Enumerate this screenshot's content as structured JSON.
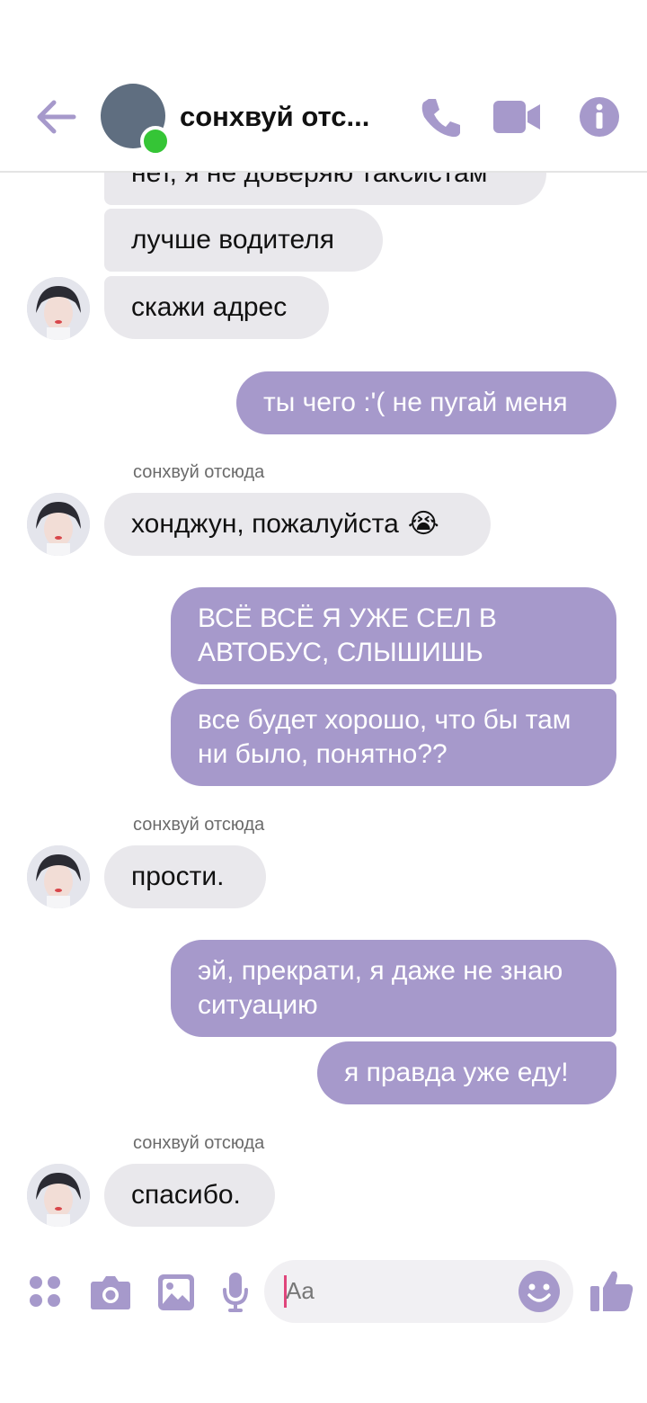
{
  "header": {
    "contact_name": "сонхвуй отсюда",
    "contact_name_display": "сонхвуй отс...",
    "icons": [
      "back-arrow-icon",
      "phone-icon",
      "video-camera-icon",
      "info-icon"
    ]
  },
  "messages": [
    {
      "from": "contact",
      "text": "нет, я не доверяю таксистам"
    },
    {
      "from": "contact",
      "text": "лучше водителя"
    },
    {
      "from": "contact",
      "text": "скажи адрес"
    },
    {
      "from": "me",
      "text": "ты чего :'( не пугай меня"
    },
    {
      "from": "contact",
      "sender": "сонхвуй отсюда",
      "text": "хонджун, пожалуйста",
      "emoji": "😭"
    },
    {
      "from": "me",
      "text": "ВСЁ ВСЁ Я УЖЕ СЕЛ В АВТОБУС, СЛЫШИШЬ"
    },
    {
      "from": "me",
      "text": "все будет хорошо, что бы там ни было, понятно??"
    },
    {
      "from": "contact",
      "sender": "сонхвуй отсюда",
      "text": "прости."
    },
    {
      "from": "me",
      "text": "эй, прекрати, я даже не знаю ситуацию"
    },
    {
      "from": "me",
      "text": "я правда уже еду!"
    },
    {
      "from": "contact",
      "sender": "сонхвуй отсюда",
      "text": "спасибо."
    }
  ],
  "composer": {
    "placeholder": "Aa",
    "icons": [
      "apps-icon",
      "camera-icon",
      "gallery-icon",
      "microphone-icon",
      "emoji-icon",
      "thumbs-up-icon"
    ]
  },
  "colors": {
    "accent": "#a699cb",
    "incoming_bubble": "#e9e8ec",
    "online": "#35c536"
  }
}
